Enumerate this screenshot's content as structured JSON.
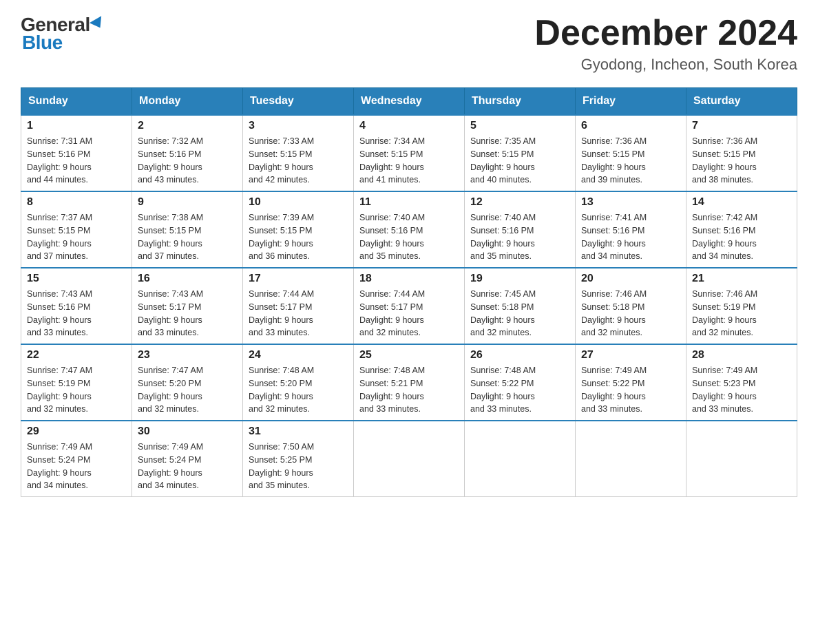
{
  "header": {
    "logo_general": "General",
    "logo_blue": "Blue",
    "month_title": "December 2024",
    "location": "Gyodong, Incheon, South Korea"
  },
  "days_of_week": [
    "Sunday",
    "Monday",
    "Tuesday",
    "Wednesday",
    "Thursday",
    "Friday",
    "Saturday"
  ],
  "weeks": [
    [
      {
        "day": "1",
        "sunrise": "7:31 AM",
        "sunset": "5:16 PM",
        "daylight_hours": "9",
        "daylight_minutes": "44"
      },
      {
        "day": "2",
        "sunrise": "7:32 AM",
        "sunset": "5:16 PM",
        "daylight_hours": "9",
        "daylight_minutes": "43"
      },
      {
        "day": "3",
        "sunrise": "7:33 AM",
        "sunset": "5:15 PM",
        "daylight_hours": "9",
        "daylight_minutes": "42"
      },
      {
        "day": "4",
        "sunrise": "7:34 AM",
        "sunset": "5:15 PM",
        "daylight_hours": "9",
        "daylight_minutes": "41"
      },
      {
        "day": "5",
        "sunrise": "7:35 AM",
        "sunset": "5:15 PM",
        "daylight_hours": "9",
        "daylight_minutes": "40"
      },
      {
        "day": "6",
        "sunrise": "7:36 AM",
        "sunset": "5:15 PM",
        "daylight_hours": "9",
        "daylight_minutes": "39"
      },
      {
        "day": "7",
        "sunrise": "7:36 AM",
        "sunset": "5:15 PM",
        "daylight_hours": "9",
        "daylight_minutes": "38"
      }
    ],
    [
      {
        "day": "8",
        "sunrise": "7:37 AM",
        "sunset": "5:15 PM",
        "daylight_hours": "9",
        "daylight_minutes": "37"
      },
      {
        "day": "9",
        "sunrise": "7:38 AM",
        "sunset": "5:15 PM",
        "daylight_hours": "9",
        "daylight_minutes": "37"
      },
      {
        "day": "10",
        "sunrise": "7:39 AM",
        "sunset": "5:15 PM",
        "daylight_hours": "9",
        "daylight_minutes": "36"
      },
      {
        "day": "11",
        "sunrise": "7:40 AM",
        "sunset": "5:16 PM",
        "daylight_hours": "9",
        "daylight_minutes": "35"
      },
      {
        "day": "12",
        "sunrise": "7:40 AM",
        "sunset": "5:16 PM",
        "daylight_hours": "9",
        "daylight_minutes": "35"
      },
      {
        "day": "13",
        "sunrise": "7:41 AM",
        "sunset": "5:16 PM",
        "daylight_hours": "9",
        "daylight_minutes": "34"
      },
      {
        "day": "14",
        "sunrise": "7:42 AM",
        "sunset": "5:16 PM",
        "daylight_hours": "9",
        "daylight_minutes": "34"
      }
    ],
    [
      {
        "day": "15",
        "sunrise": "7:43 AM",
        "sunset": "5:16 PM",
        "daylight_hours": "9",
        "daylight_minutes": "33"
      },
      {
        "day": "16",
        "sunrise": "7:43 AM",
        "sunset": "5:17 PM",
        "daylight_hours": "9",
        "daylight_minutes": "33"
      },
      {
        "day": "17",
        "sunrise": "7:44 AM",
        "sunset": "5:17 PM",
        "daylight_hours": "9",
        "daylight_minutes": "33"
      },
      {
        "day": "18",
        "sunrise": "7:44 AM",
        "sunset": "5:17 PM",
        "daylight_hours": "9",
        "daylight_minutes": "32"
      },
      {
        "day": "19",
        "sunrise": "7:45 AM",
        "sunset": "5:18 PM",
        "daylight_hours": "9",
        "daylight_minutes": "32"
      },
      {
        "day": "20",
        "sunrise": "7:46 AM",
        "sunset": "5:18 PM",
        "daylight_hours": "9",
        "daylight_minutes": "32"
      },
      {
        "day": "21",
        "sunrise": "7:46 AM",
        "sunset": "5:19 PM",
        "daylight_hours": "9",
        "daylight_minutes": "32"
      }
    ],
    [
      {
        "day": "22",
        "sunrise": "7:47 AM",
        "sunset": "5:19 PM",
        "daylight_hours": "9",
        "daylight_minutes": "32"
      },
      {
        "day": "23",
        "sunrise": "7:47 AM",
        "sunset": "5:20 PM",
        "daylight_hours": "9",
        "daylight_minutes": "32"
      },
      {
        "day": "24",
        "sunrise": "7:48 AM",
        "sunset": "5:20 PM",
        "daylight_hours": "9",
        "daylight_minutes": "32"
      },
      {
        "day": "25",
        "sunrise": "7:48 AM",
        "sunset": "5:21 PM",
        "daylight_hours": "9",
        "daylight_minutes": "33"
      },
      {
        "day": "26",
        "sunrise": "7:48 AM",
        "sunset": "5:22 PM",
        "daylight_hours": "9",
        "daylight_minutes": "33"
      },
      {
        "day": "27",
        "sunrise": "7:49 AM",
        "sunset": "5:22 PM",
        "daylight_hours": "9",
        "daylight_minutes": "33"
      },
      {
        "day": "28",
        "sunrise": "7:49 AM",
        "sunset": "5:23 PM",
        "daylight_hours": "9",
        "daylight_minutes": "33"
      }
    ],
    [
      {
        "day": "29",
        "sunrise": "7:49 AM",
        "sunset": "5:24 PM",
        "daylight_hours": "9",
        "daylight_minutes": "34"
      },
      {
        "day": "30",
        "sunrise": "7:49 AM",
        "sunset": "5:24 PM",
        "daylight_hours": "9",
        "daylight_minutes": "34"
      },
      {
        "day": "31",
        "sunrise": "7:50 AM",
        "sunset": "5:25 PM",
        "daylight_hours": "9",
        "daylight_minutes": "35"
      },
      null,
      null,
      null,
      null
    ]
  ],
  "labels": {
    "sunrise_prefix": "Sunrise: ",
    "sunset_prefix": "Sunset: ",
    "daylight_prefix": "Daylight: ",
    "hours_suffix": " hours",
    "and": "and ",
    "minutes_suffix": " minutes."
  }
}
